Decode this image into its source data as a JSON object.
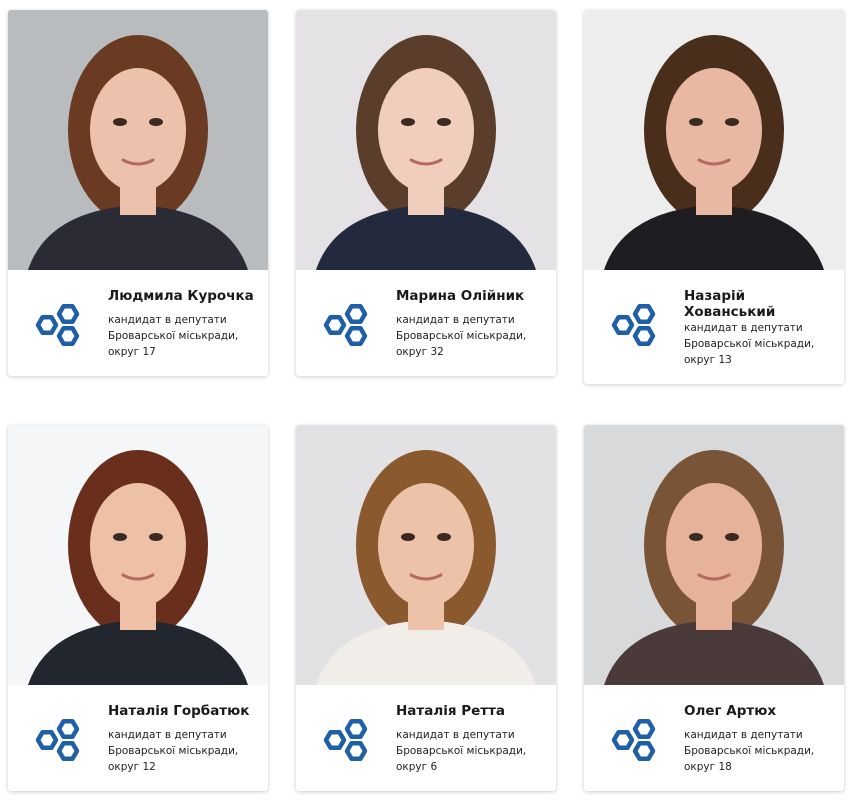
{
  "brand": {
    "accent": "#1f5fa8"
  },
  "candidates": [
    {
      "name": "Людмила Курочка",
      "line1": "кандидат в депутати",
      "line2": "Броварської міськради,",
      "line3": "округ 17",
      "bg": "#b9bcbe",
      "hair": "#6b3a22",
      "skin": "#ecc2ad",
      "clothes": "#2b2b36"
    },
    {
      "name": "Марина Олійник",
      "line1": "кандидат в депутати",
      "line2": "Броварської міськради,",
      "line3": "округ 32",
      "bg": "#e4e2e4",
      "hair": "#5a3d2a",
      "skin": "#f0cdbd",
      "clothes": "#232a3e"
    },
    {
      "name": "Назарій Хованський",
      "line1": "кандидат в депутати",
      "line2": "Броварської міськради,",
      "line3": "округ 13",
      "bg": "#ededed",
      "hair": "#4a2e1c",
      "skin": "#e9b8a3",
      "clothes": "#1d1d22"
    },
    {
      "name": "Наталія Горбатюк",
      "line1": "кандидат в депутати",
      "line2": "Броварської міськради,",
      "line3": "округ 12",
      "bg": "#f4f6f8",
      "hair": "#6a2f1c",
      "skin": "#eec0a6",
      "clothes": "#22262e"
    },
    {
      "name": "Наталія Ретта",
      "line1": "кандидат в депутати",
      "line2": "Броварської міськради,",
      "line3": "округ 6",
      "bg": "#e2e2e4",
      "hair": "#8a5a2e",
      "skin": "#ecc3a8",
      "clothes": "#f1eeea"
    },
    {
      "name": "Олег Артюх",
      "line1": "кандидат в депутати",
      "line2": "Броварської міськради,",
      "line3": "округ 18",
      "bg": "#d8d9db",
      "hair": "#7a5436",
      "skin": "#e6b29a",
      "clothes": "#4a3a3a"
    }
  ]
}
